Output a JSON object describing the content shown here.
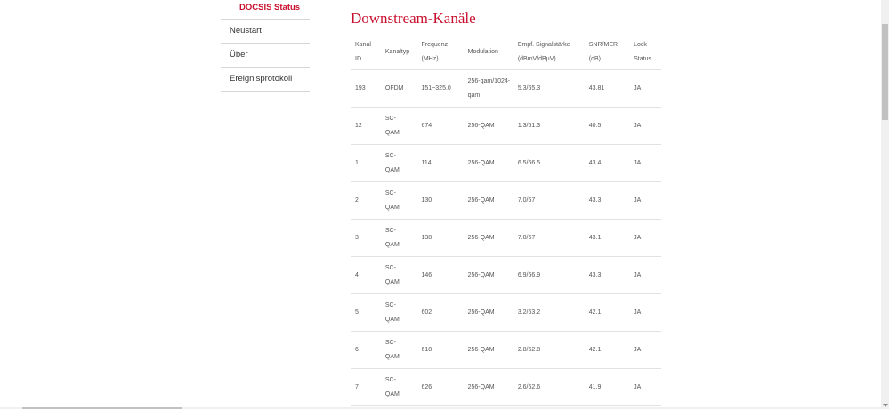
{
  "sidebar": {
    "items": [
      {
        "label": "DOCSIS Status",
        "active": true
      },
      {
        "label": "Neustart"
      },
      {
        "label": "Über"
      },
      {
        "label": "Ereignisprotokoll"
      }
    ]
  },
  "main": {
    "title": "Downstream-Kanäle",
    "columns": [
      {
        "line1": "Kanal",
        "line2": "ID"
      },
      {
        "line1": "Kanaltyp",
        "line2": ""
      },
      {
        "line1": "Frequenz",
        "line2": "(MHz)"
      },
      {
        "line1": "Modulation",
        "line2": ""
      },
      {
        "line1": "Empf. Signalstärke",
        "line2": "(dBmV/dBµV)"
      },
      {
        "line1": "SNR/MER",
        "line2": "(dB)"
      },
      {
        "line1": "Lock",
        "line2": "Status"
      }
    ],
    "rows": [
      {
        "id": "193",
        "typ1": "OFDM",
        "typ2": "",
        "freq": "151~325.0",
        "mod1": "256-qam/1024-",
        "mod2": "qam",
        "pwr": "5.3/65.3",
        "snr": "43.81",
        "lock": "JA"
      },
      {
        "id": "12",
        "typ1": "SC-",
        "typ2": "QAM",
        "freq": "674",
        "mod1": "256-QAM",
        "mod2": "",
        "pwr": "1.3/61.3",
        "snr": "40.5",
        "lock": "JA"
      },
      {
        "id": "1",
        "typ1": "SC-",
        "typ2": "QAM",
        "freq": "114",
        "mod1": "256-QAM",
        "mod2": "",
        "pwr": "6.5/66.5",
        "snr": "43.4",
        "lock": "JA"
      },
      {
        "id": "2",
        "typ1": "SC-",
        "typ2": "QAM",
        "freq": "130",
        "mod1": "256-QAM",
        "mod2": "",
        "pwr": "7.0/67",
        "snr": "43.3",
        "lock": "JA"
      },
      {
        "id": "3",
        "typ1": "SC-",
        "typ2": "QAM",
        "freq": "138",
        "mod1": "256-QAM",
        "mod2": "",
        "pwr": "7.0/67",
        "snr": "43.1",
        "lock": "JA"
      },
      {
        "id": "4",
        "typ1": "SC-",
        "typ2": "QAM",
        "freq": "146",
        "mod1": "256-QAM",
        "mod2": "",
        "pwr": "6.9/66.9",
        "snr": "43.3",
        "lock": "JA"
      },
      {
        "id": "5",
        "typ1": "SC-",
        "typ2": "QAM",
        "freq": "602",
        "mod1": "256-QAM",
        "mod2": "",
        "pwr": "3.2/63.2",
        "snr": "42.1",
        "lock": "JA"
      },
      {
        "id": "6",
        "typ1": "SC-",
        "typ2": "QAM",
        "freq": "618",
        "mod1": "256-QAM",
        "mod2": "",
        "pwr": "2.8/62.8",
        "snr": "42.1",
        "lock": "JA"
      },
      {
        "id": "7",
        "typ1": "SC-",
        "typ2": "QAM",
        "freq": "626",
        "mod1": "256-QAM",
        "mod2": "",
        "pwr": "2.6/62.6",
        "snr": "41.9",
        "lock": "JA"
      }
    ]
  },
  "colors": {
    "accent": "#c8102e",
    "divider": "#e2e2e2",
    "text": "#555555"
  }
}
